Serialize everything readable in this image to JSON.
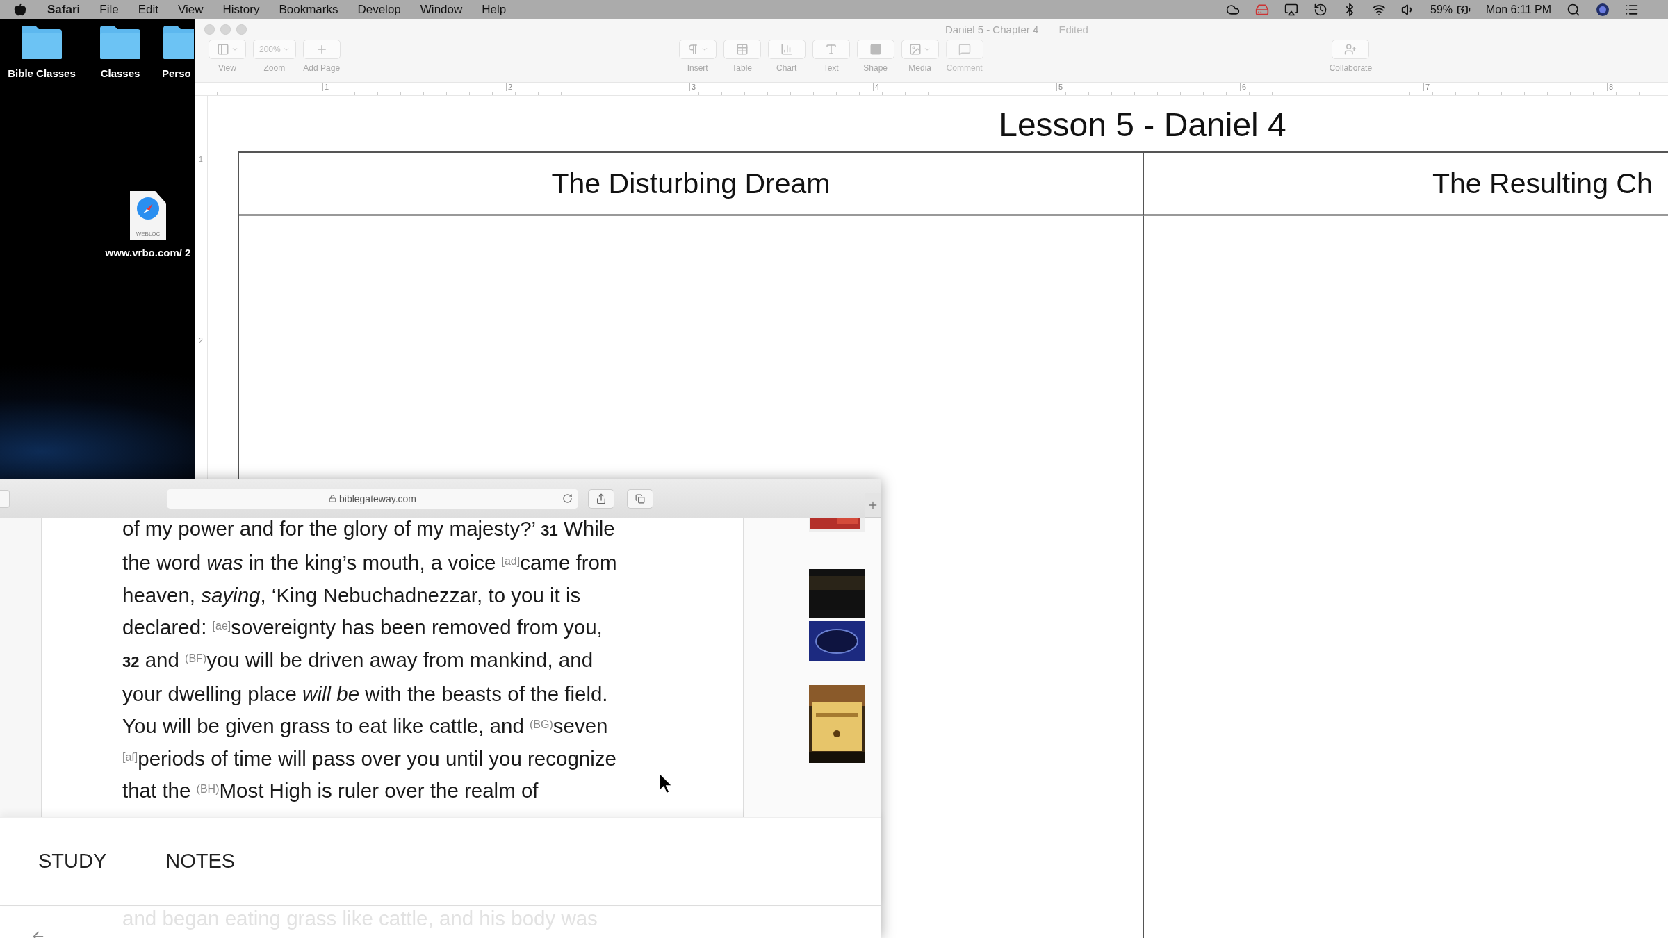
{
  "menu_bar": {
    "app": "Safari",
    "items": [
      "File",
      "Edit",
      "View",
      "History",
      "Bookmarks",
      "Develop",
      "Window",
      "Help"
    ],
    "battery": "59%",
    "clock": "Mon 6:11 PM"
  },
  "desktop": {
    "icons": [
      {
        "kind": "folder",
        "label": "Bible Classes"
      },
      {
        "kind": "folder",
        "label": "Classes"
      },
      {
        "kind": "folder",
        "label": "Perso"
      },
      {
        "kind": "file",
        "label": "www.vrbo.com/ 2",
        "badge": "WEBLOC"
      }
    ]
  },
  "pages_window": {
    "title": "Daniel 5 - Chapter 4",
    "status": "— Edited",
    "toolbar_left": [
      {
        "kind": "view",
        "label": "View",
        "disabled": false
      },
      {
        "kind": "zoom",
        "label": "Zoom",
        "value": "200%",
        "disabled": false
      },
      {
        "kind": "add",
        "label": "Add Page",
        "disabled": false
      }
    ],
    "toolbar_middle": [
      {
        "kind": "insert",
        "label": "Insert",
        "disabled": false
      },
      {
        "kind": "table",
        "label": "Table",
        "disabled": false
      },
      {
        "kind": "chart",
        "label": "Chart",
        "disabled": false
      },
      {
        "kind": "text",
        "label": "Text",
        "disabled": false
      },
      {
        "kind": "shape",
        "label": "Shape",
        "disabled": false
      },
      {
        "kind": "media",
        "label": "Media",
        "disabled": false
      },
      {
        "kind": "comment",
        "label": "Comment",
        "disabled": true
      }
    ],
    "toolbar_right": [
      {
        "kind": "collaborate",
        "label": "Collaborate",
        "disabled": false
      }
    ],
    "ruler": [
      "1",
      "2",
      "3",
      "4",
      "5",
      "6",
      "7",
      "8"
    ],
    "side_ruler": [
      "1",
      "2"
    ],
    "document": {
      "heading": "Lesson 5 - Daniel 4",
      "columns": [
        "The Disturbing Dream",
        "The Resulting Ch"
      ]
    }
  },
  "safari_window": {
    "address": "biblegateway.com",
    "passage": [
      "of my power and for the glory of my majesty?’ **31** While",
      "the word *was* in the king’s mouth, a voice $^{[ad]}$came from",
      "heaven, *saying*, ‘King Nebuchadnezzar, to you it is",
      "declared: $^{[ae]}$sovereignty has been removed from you,",
      "**32** and $^{(BF)}$you will be driven away from mankind, and",
      "your dwelling place *will be* with the beasts of the field.",
      "You will be given grass to eat like cattle, and $^{(BG)}$seven",
      "$^{[af]}$periods of time will pass over you until you recognize",
      "that the $^{(BH)}$Most High is ruler over the realm of"
    ],
    "tabs": [
      "STUDY",
      "NOTES"
    ],
    "next_line": "and began eating grass like cattle, and his body was"
  }
}
